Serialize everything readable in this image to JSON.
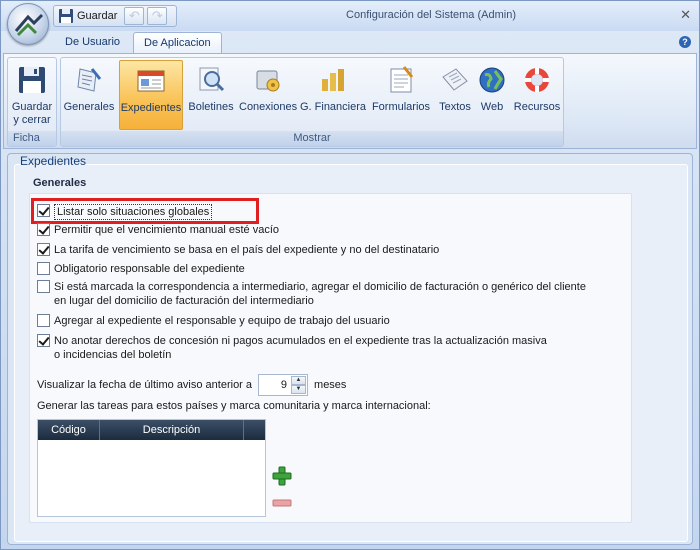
{
  "window": {
    "title": "Configuración del Sistema (Admin)"
  },
  "quick_access": {
    "save_label": "Guardar"
  },
  "tabs": [
    {
      "label": "De Usuario",
      "active": false
    },
    {
      "label": "De Aplicacion",
      "active": true
    }
  ],
  "ribbon": {
    "ficha": {
      "label": "Ficha",
      "save_close": {
        "line1": "Guardar",
        "line2": "y cerrar"
      }
    },
    "mostrar": {
      "label": "Mostrar",
      "buttons": [
        {
          "label": "Generales",
          "icon": "generales-icon"
        },
        {
          "label": "Expedientes",
          "icon": "expedientes-icon",
          "selected": true
        },
        {
          "label": "Boletines",
          "icon": "boletines-icon"
        },
        {
          "label": "Conexiones",
          "icon": "conexiones-icon"
        },
        {
          "label": "G. Financiera",
          "icon": "financiera-icon"
        },
        {
          "label": "Formularios",
          "icon": "formularios-icon"
        },
        {
          "label": "Textos",
          "icon": "textos-icon"
        },
        {
          "label": "Web",
          "icon": "web-icon"
        },
        {
          "label": "Recursos",
          "icon": "recursos-icon"
        }
      ]
    }
  },
  "section": {
    "title": "Expedientes",
    "subtitle": "Generales",
    "options": [
      {
        "label": "Listar solo situaciones globales",
        "checked": true
      },
      {
        "label": "Permitir que el vencimiento manual esté vacío",
        "checked": true
      },
      {
        "label": "La tarifa de vencimiento se basa en el país del expediente y no del destinatario",
        "checked": true
      },
      {
        "label": "Obligatorio responsable del expediente",
        "checked": false
      },
      {
        "line1": "Si está marcada la correspondencia a intermediario, agregar el domicilio de facturación o genérico del cliente",
        "line2": "en lugar del domicilio de facturación del intermediario",
        "checked": false
      },
      {
        "label": "Agregar al expediente el responsable y equipo de trabajo del usuario",
        "checked": false
      },
      {
        "line1": "No anotar derechos de concesión ni pagos acumulados en el expediente tras la actualización masiva",
        "line2": "o incidencias del boletín",
        "checked": true
      }
    ],
    "last_notice": {
      "prefix": "Visualizar la fecha de último aviso anterior a",
      "value": "9",
      "suffix": "meses"
    },
    "tasks_label": "Generar las tareas para estos países y marca comunitaria y marca internacional:",
    "grid_columns": [
      "Código",
      "Descripción"
    ]
  },
  "colors": {
    "accent": "#f9c45a",
    "highlight": "#e02020",
    "grid_header": "#1c2c3f"
  }
}
